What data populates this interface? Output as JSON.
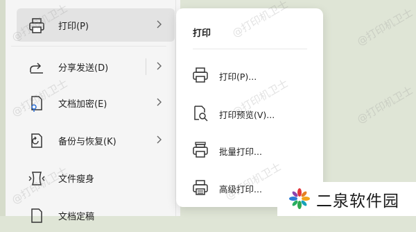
{
  "menu": {
    "items": [
      {
        "label": "打印(P)",
        "icon": "printer-icon",
        "has_submenu": true,
        "active": true
      },
      {
        "label": "分享发送(D)",
        "icon": "share-icon",
        "has_submenu": true,
        "active": false
      },
      {
        "label": "文档加密(E)",
        "icon": "document-lock-icon",
        "has_submenu": true,
        "active": false
      },
      {
        "label": "备份与恢复(K)",
        "icon": "backup-restore-icon",
        "has_submenu": true,
        "active": false
      },
      {
        "label": "文件瘦身",
        "icon": "file-slim-icon",
        "has_submenu": false,
        "active": false
      },
      {
        "label": "文档定稿",
        "icon": "document-finalize-icon",
        "has_submenu": false,
        "active": false
      }
    ]
  },
  "submenu": {
    "title": "打印",
    "items": [
      {
        "label": "打印(P)...",
        "icon": "printer-icon"
      },
      {
        "label": "打印预览(V)...",
        "icon": "print-preview-icon"
      },
      {
        "label": "批量打印...",
        "icon": "batch-print-icon"
      },
      {
        "label": "高级打印...",
        "icon": "advanced-print-icon"
      }
    ]
  },
  "watermark": {
    "text": "@打印机卫士",
    "site_name": "二泉软件园"
  },
  "colors": {
    "background": "#dfe5d6",
    "menu_bg": "#f5f5f5",
    "active_bg": "#e3e3e3",
    "submenu_bg": "#ffffff"
  }
}
